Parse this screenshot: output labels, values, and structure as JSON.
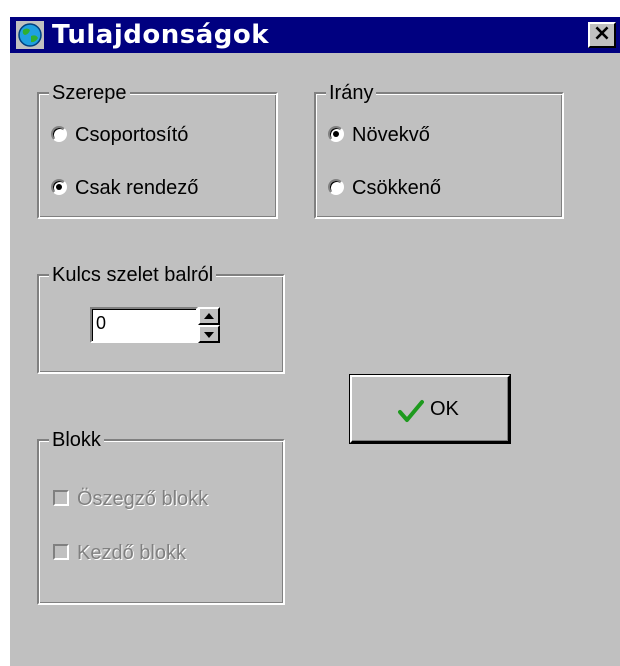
{
  "window": {
    "title": "Tulajdonságok",
    "close_label": "×"
  },
  "colors": {
    "titlebar": "#000080",
    "face": "#c0c0c0",
    "ok_check": "#1e9a1e"
  },
  "szerepe": {
    "label": "Szerepe",
    "options": [
      {
        "label": "Csoportosító",
        "selected": false
      },
      {
        "label": "Csak rendező",
        "selected": true
      }
    ]
  },
  "irany": {
    "label": "Irány",
    "options": [
      {
        "label": "Növekvő",
        "selected": true
      },
      {
        "label": "Csökkenő",
        "selected": false
      }
    ]
  },
  "kulcs": {
    "label": "Kulcs szelet balról",
    "value": "0"
  },
  "blokk": {
    "label": "Blokk",
    "options": [
      {
        "label": "Öszegző blokk",
        "checked": false,
        "disabled": true
      },
      {
        "label": "Kezdő blokk",
        "checked": false,
        "disabled": true
      }
    ]
  },
  "ok_button": {
    "label": "OK",
    "icon": "checkmark-icon"
  }
}
